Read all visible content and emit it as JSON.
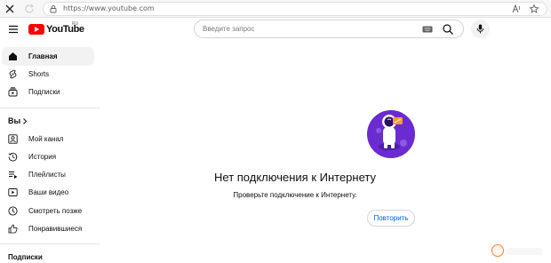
{
  "browser": {
    "url": "https://www.youtube.com",
    "icons": [
      "close-icon",
      "reload-icon",
      "lock-icon",
      "read-aloud-icon",
      "favorite-icon"
    ]
  },
  "header": {
    "logo_text": "YouTube",
    "logo_country": "RU",
    "search_placeholder": "Введите запрос",
    "icons": [
      "menu-icon",
      "keyboard-icon",
      "search-icon",
      "mic-icon"
    ]
  },
  "sidebar": {
    "primary": [
      {
        "label": "Главная",
        "icon": "home-icon",
        "active": true
      },
      {
        "label": "Shorts",
        "icon": "shorts-icon",
        "active": false
      },
      {
        "label": "Подписки",
        "icon": "subscriptions-icon",
        "active": false
      }
    ],
    "you_heading": "Вы",
    "you_items": [
      {
        "label": "Мой канал",
        "icon": "channel-icon"
      },
      {
        "label": "История",
        "icon": "history-icon"
      },
      {
        "label": "Плейлисты",
        "icon": "playlists-icon"
      },
      {
        "label": "Ваши видео",
        "icon": "your-videos-icon"
      },
      {
        "label": "Смотреть позже",
        "icon": "watch-later-icon"
      },
      {
        "label": "Понравившиеся",
        "icon": "liked-icon"
      }
    ],
    "subscriptions_heading": "Подписки"
  },
  "main": {
    "title": "Нет подключения к Интернету",
    "subtitle": "Проверьте подключение к Интернету.",
    "retry_label": "Повторить",
    "illustration": "astronaut-icon"
  },
  "colors": {
    "brand_red": "#ff0000",
    "link_blue": "#065fd4",
    "illustration_purple": "#6a2bd1"
  }
}
